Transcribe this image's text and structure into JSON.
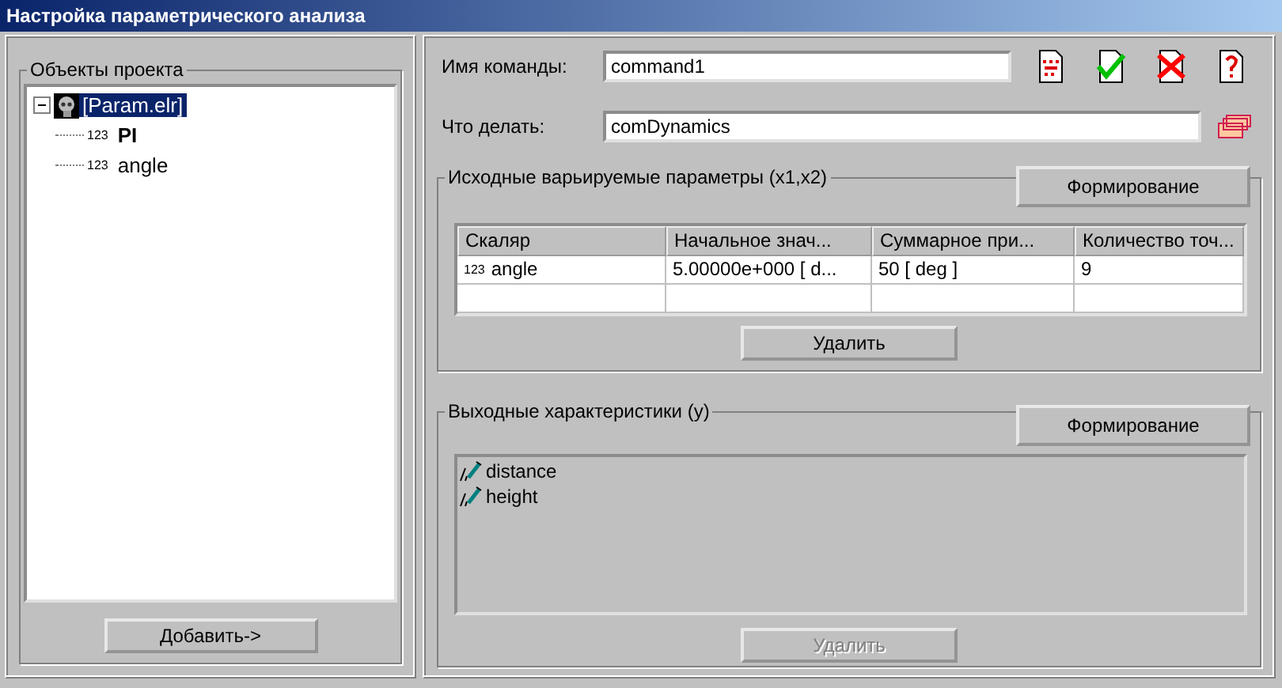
{
  "window": {
    "title": "Настройка параметрического анализа"
  },
  "objects_panel": {
    "title": "Объекты проекта",
    "tree": [
      {
        "label": "[Param.elr]",
        "selected": true,
        "expanded": true,
        "children": [
          {
            "badge": "123",
            "label": "PI",
            "selected": false,
            "bold": true
          },
          {
            "badge": "123",
            "label": "angle",
            "selected": false,
            "bold": false
          }
        ]
      }
    ],
    "add_button": "Добавить->"
  },
  "command": {
    "label": "Имя команды:",
    "value": "command1"
  },
  "action": {
    "label": "Что делать:",
    "value": "comDynamics"
  },
  "inputs_group": {
    "title": "Исходные варьируемые параметры (x1,x2)",
    "form_button": "Формирование",
    "table": {
      "columns": [
        "Скаляр",
        "Начальное знач...",
        "Суммарное при...",
        "Количество точ..."
      ],
      "rows": [
        {
          "badge": "123",
          "cells": [
            "angle",
            "5.00000e+000  [ d...",
            "50  [ deg ]",
            "9"
          ]
        }
      ]
    },
    "delete_button": {
      "label": "Удалить",
      "disabled": false
    }
  },
  "outputs_group": {
    "title": "Выходные характеристики (y)",
    "form_button": "Формирование",
    "items": [
      "distance",
      "height"
    ],
    "delete_button": {
      "label": "Удалить",
      "disabled": true
    }
  }
}
